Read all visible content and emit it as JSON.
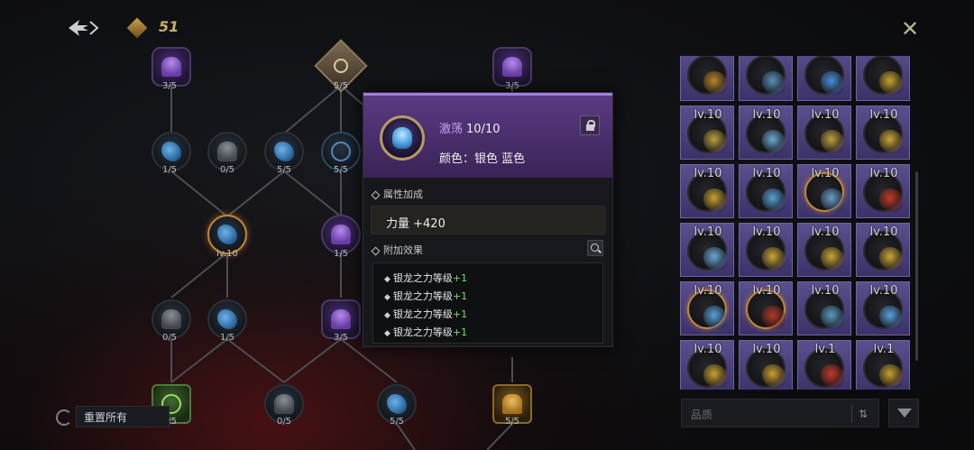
{
  "header": {
    "currency_value": "51",
    "close_label": "✕"
  },
  "skill_tree": {
    "nodes": [
      {
        "id": "n1",
        "label": "3/5"
      },
      {
        "id": "n2",
        "label": "5/5"
      },
      {
        "id": "n3",
        "label": "3/5"
      },
      {
        "id": "n4",
        "label": "1/5"
      },
      {
        "id": "n5",
        "label": "0/5"
      },
      {
        "id": "n6",
        "label": "5/5"
      },
      {
        "id": "n7",
        "label": "5/5"
      },
      {
        "id": "n8",
        "label": "lv.10"
      },
      {
        "id": "n9",
        "label": "1/5"
      },
      {
        "id": "n10",
        "label": "0/5"
      },
      {
        "id": "n11",
        "label": "1/5"
      },
      {
        "id": "n12",
        "label": "3/5"
      },
      {
        "id": "n13",
        "label": "3/5"
      },
      {
        "id": "n14",
        "label": "0/5"
      },
      {
        "id": "n15",
        "label": "5/5"
      },
      {
        "id": "n16",
        "label": "5/5"
      }
    ],
    "reset_label": "重置所有"
  },
  "popup": {
    "name": "激荡",
    "level": "10/10",
    "color_line": "颜色：银色 蓝色",
    "attr_section": "属性加成",
    "attr_value": "力量 +420",
    "effect_section": "附加效果",
    "effects": [
      {
        "text": "银龙之力等级",
        "plus": "+1"
      },
      {
        "text": "银龙之力等级",
        "plus": "+1"
      },
      {
        "text": "银龙之力等级",
        "plus": "+1"
      },
      {
        "text": "银龙之力等级",
        "plus": "+1"
      }
    ]
  },
  "inventory": {
    "slots": [
      {
        "lv": "",
        "color": "#b9862c",
        "ring": false
      },
      {
        "lv": "",
        "color": "#5a8fb8",
        "ring": false
      },
      {
        "lv": "",
        "color": "#4a90d8",
        "ring": false
      },
      {
        "lv": "",
        "color": "#c9a030",
        "ring": false
      },
      {
        "lv": "lv.10",
        "color": "#b9a040",
        "ring": false
      },
      {
        "lv": "lv.10",
        "color": "#6aa8d0",
        "ring": false
      },
      {
        "lv": "lv.10",
        "color": "#c0a040",
        "ring": false
      },
      {
        "lv": "lv.10",
        "color": "#c9a538",
        "ring": false
      },
      {
        "lv": "lv.10",
        "color": "#c9a030",
        "ring": false
      },
      {
        "lv": "lv.10",
        "color": "#5aa0d8",
        "ring": false
      },
      {
        "lv": "lv.10",
        "color": "#6a9ac8",
        "ring": true
      },
      {
        "lv": "lv.10",
        "color": "#c03a2a",
        "ring": false
      },
      {
        "lv": "lv.10",
        "color": "#6aa8d8",
        "ring": false
      },
      {
        "lv": "lv.10",
        "color": "#c9a538",
        "ring": false
      },
      {
        "lv": "lv.10",
        "color": "#c9a538",
        "ring": false
      },
      {
        "lv": "lv.10",
        "color": "#c9a538",
        "ring": false
      },
      {
        "lv": "lv.10",
        "color": "#5aa0d8",
        "ring": true
      },
      {
        "lv": "lv.10",
        "color": "#b03a2a",
        "ring": true
      },
      {
        "lv": "lv.10",
        "color": "#5a9ac0",
        "ring": false
      },
      {
        "lv": "lv.10",
        "color": "#5aa0d8",
        "ring": false
      },
      {
        "lv": "lv.10",
        "color": "#c9a030",
        "ring": false
      },
      {
        "lv": "lv.10",
        "color": "#c9a030",
        "ring": false
      },
      {
        "lv": "lv.1",
        "color": "#c03a2a",
        "ring": false
      },
      {
        "lv": "lv.1",
        "color": "#c9a030",
        "ring": false
      }
    ],
    "search_placeholder": "品质"
  },
  "colors": {
    "popup_accent": "#a67de0",
    "plus_green": "#6fe06f"
  }
}
